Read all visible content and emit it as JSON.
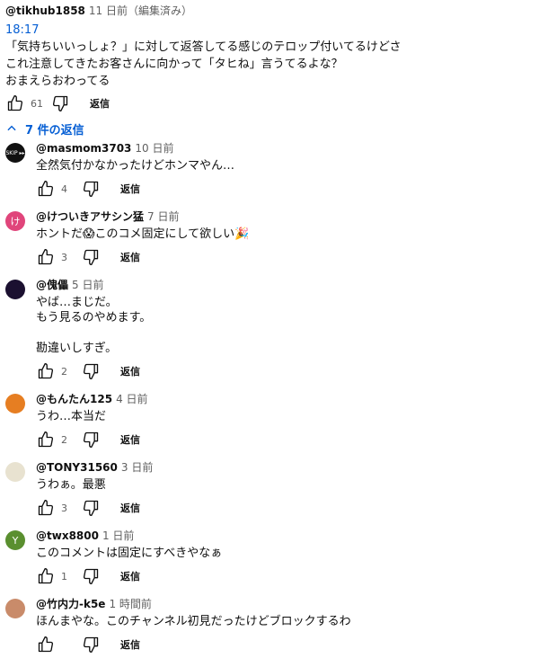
{
  "main": {
    "author": "@tikhub1858",
    "time": "11 日前",
    "edited": "（編集済み）",
    "timestamp_link": "18:17",
    "text": "「気持ちいいっしょ？」に対して返答してる感じのテロップ付いてるけどさ\nこれ注意してきたお客さんに向かって「タヒね」言うてるよな？\nおまえらおわってる",
    "likes": "61",
    "reply_label": "返信"
  },
  "expander": {
    "label": "7 件の返信"
  },
  "replies": [
    {
      "author": "@masmom3703",
      "time": "10 日前",
      "text": "全然気付かなかったけどホンマやん…",
      "likes": "4",
      "reply_label": "返信",
      "avatar_text": "SKIP ▸▸",
      "avatar_color": "#111111"
    },
    {
      "author": "@けついきアサシン猛",
      "time": "7 日前",
      "text": "ホントだ😱このコメ固定にして欲しい🎉",
      "likes": "3",
      "reply_label": "返信",
      "avatar_text": "け",
      "avatar_color": "#e0457b"
    },
    {
      "author": "@傀儡",
      "time": "5 日前",
      "text": "やば…まじだ。\nもう見るのやめます。\n\n勘違いしすぎ。",
      "likes": "2",
      "reply_label": "返信",
      "avatar_text": "",
      "avatar_color": "#1b1030"
    },
    {
      "author": "@もんたん125",
      "time": "4 日前",
      "text": "うわ…本当だ",
      "likes": "2",
      "reply_label": "返信",
      "avatar_text": "",
      "avatar_color": "#e67e22"
    },
    {
      "author": "@TONY31560",
      "time": "3 日前",
      "text": "うわぁ。最悪",
      "likes": "3",
      "reply_label": "返信",
      "avatar_text": "",
      "avatar_color": "#e8e2d0"
    },
    {
      "author": "@twx8800",
      "time": "1 日前",
      "text": "このコメントは固定にすべきやなぁ",
      "likes": "1",
      "reply_label": "返信",
      "avatar_text": "Y",
      "avatar_color": "#5a8f2f"
    },
    {
      "author": "@竹内力-k5e",
      "time": "1 時間前",
      "text": "ほんまやな。このチャンネル初見だったけどブロックするわ",
      "likes": "",
      "reply_label": "返信",
      "avatar_text": "",
      "avatar_color": "#c98b6a"
    }
  ]
}
